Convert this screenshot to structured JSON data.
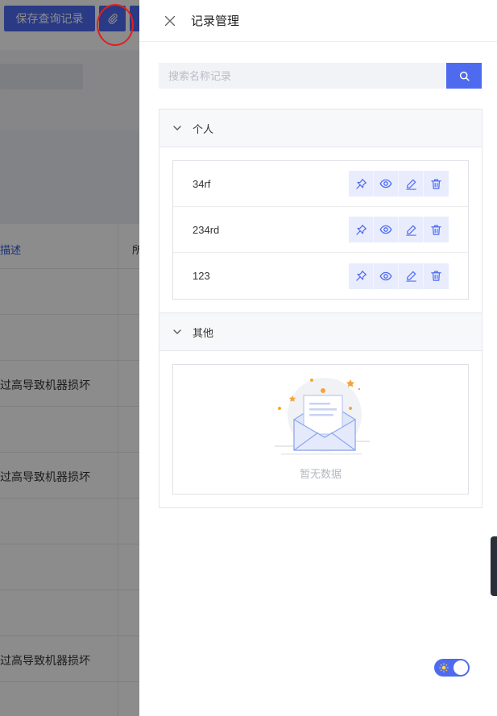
{
  "background": {
    "save_query_label": "保存查询记录",
    "table_header_desc": "描述",
    "table_header_col2": "所",
    "rows": [
      "",
      "",
      "过高导致机器损坏",
      "",
      "过高导致机器损坏",
      "",
      "",
      "",
      "过高导致机器损坏",
      ""
    ]
  },
  "drawer": {
    "title": "记录管理",
    "search": {
      "placeholder": "搜索名称记录",
      "value": ""
    },
    "panels": {
      "personal": {
        "label": "个人",
        "records": [
          "34rf",
          "234rd",
          "123"
        ]
      },
      "other": {
        "label": "其他",
        "empty_text": "暂无数据"
      }
    }
  },
  "colors": {
    "primary": "#4e6bf0",
    "action_bg": "#e8ecfd",
    "highlight_circle": "#e02020"
  },
  "icons": {
    "close": "close-icon",
    "search": "search-icon",
    "chevron": "chevron-down-icon",
    "pin": "pin-icon",
    "view": "eye-icon",
    "edit": "edit-icon",
    "delete": "trash-icon",
    "attach": "paperclip-icon",
    "theme": "sun-icon"
  }
}
